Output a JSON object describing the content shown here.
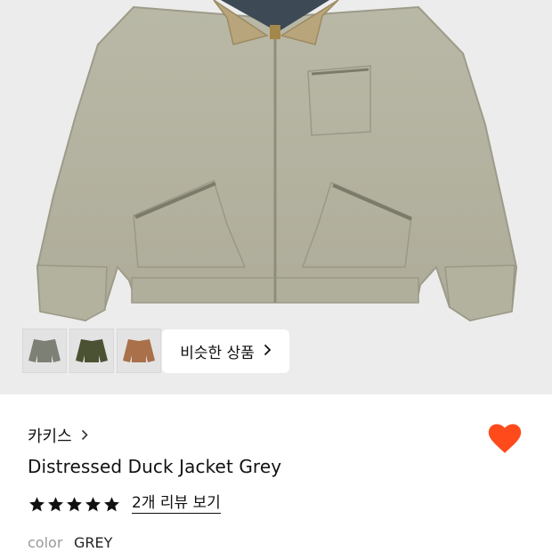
{
  "gallery": {
    "similar_button_label": "비슷한 상품",
    "thumbnails": [
      {
        "name": "thumb-grey",
        "color": "#7d8075"
      },
      {
        "name": "thumb-olive",
        "color": "#4b5234"
      },
      {
        "name": "thumb-brown",
        "color": "#a9704a"
      }
    ]
  },
  "product": {
    "brand": "카키스",
    "title": "Distressed Duck Jacket Grey",
    "rating": 5,
    "reviews_label": "2개 리뷰 보기",
    "option_label": "color",
    "option_value": "GREY"
  },
  "colors": {
    "accent": "#ff4a1c",
    "jacket": "#b6b5a3",
    "collar": "#b8a57b"
  },
  "icons": {
    "heart": "heart-icon",
    "star": "star-icon",
    "chevron": "chevron-right-icon"
  }
}
